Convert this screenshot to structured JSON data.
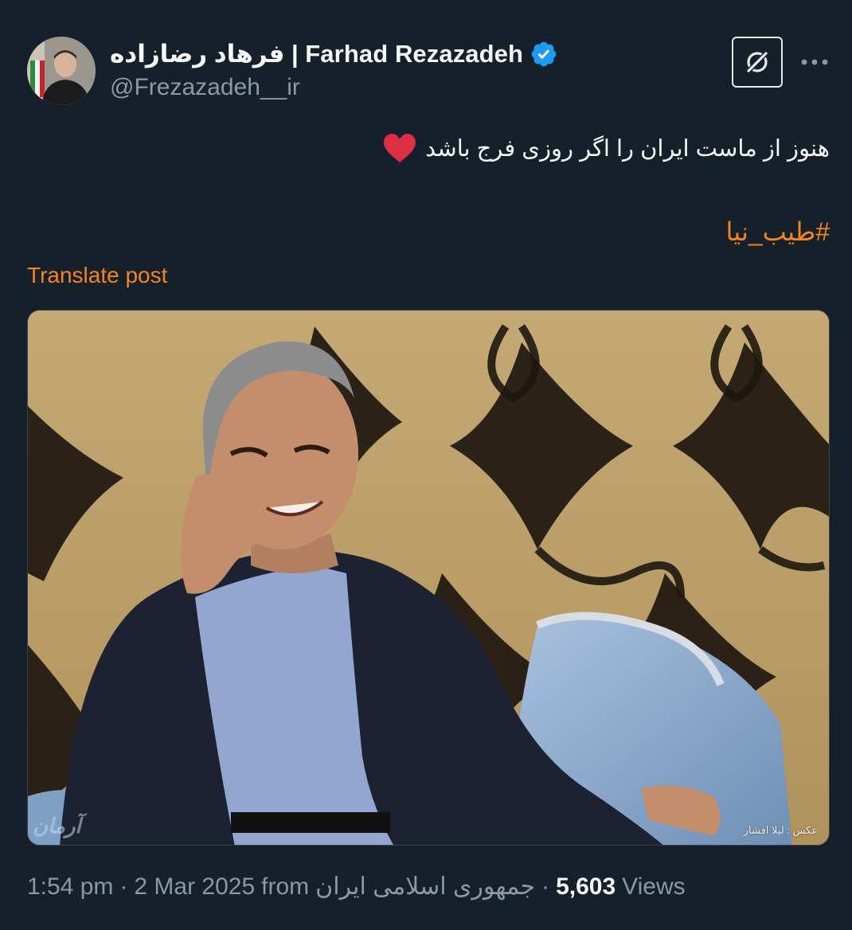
{
  "author": {
    "display_name": "فرهاد رضازاده | Farhad Rezazadeh",
    "handle": "@Frezazadeh__ir",
    "verified": true,
    "avatar_icon": "user-avatar"
  },
  "actions": {
    "grok_icon": "grok-icon",
    "more_icon": "more-dots-icon"
  },
  "post": {
    "text": "هنوز از ماست ایران را اگر روزی فرج باشد",
    "emoji": "heart-icon",
    "hashtag": "#طیب_نیا",
    "translate_label": "Translate post"
  },
  "media": {
    "photo_credit": "عکس : لیلا افشار",
    "watermark": "آرمان"
  },
  "footer": {
    "time": "1:54 pm",
    "date": "2 Mar 2025",
    "from_label": "from",
    "source": "جمهوری اسلامی ایران",
    "views_count": "5,603",
    "views_label": "Views"
  },
  "colors": {
    "background": "#15202b",
    "accent": "#f4841e",
    "verified": "#1d9bf0",
    "secondary_text": "#8b98a5"
  }
}
